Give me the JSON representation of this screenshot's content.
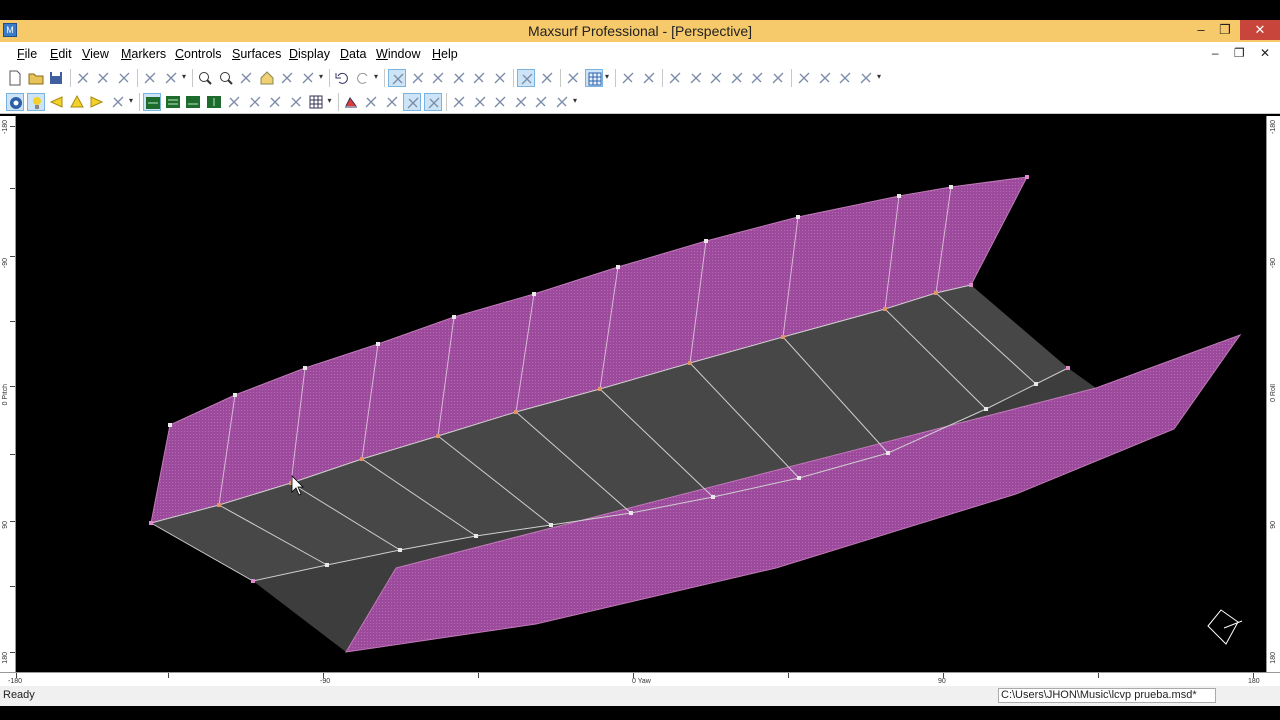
{
  "window": {
    "title": "Maxsurf Professional - [Perspective]",
    "app_icon": "M",
    "controls": {
      "minimize": "–",
      "restore": "❐",
      "close": "✕"
    }
  },
  "menu": [
    {
      "label": "File",
      "u": "F",
      "rest": "ile"
    },
    {
      "label": "Edit",
      "u": "E",
      "rest": "dit"
    },
    {
      "label": "View",
      "u": "V",
      "rest": "iew"
    },
    {
      "label": "Markers",
      "u": "M",
      "rest": "arkers"
    },
    {
      "label": "Controls",
      "u": "C",
      "rest": "ontrols"
    },
    {
      "label": "Surfaces",
      "u": "S",
      "rest": "urfaces"
    },
    {
      "label": "Display",
      "u": "D",
      "rest": "isplay"
    },
    {
      "label": "Data",
      "u": "D",
      "rest": "ata"
    },
    {
      "label": "Window",
      "u": "W",
      "rest": "indow"
    },
    {
      "label": "Help",
      "u": "H",
      "rest": "elp"
    }
  ],
  "mdi_controls": "– ❐ ✕",
  "toolbar1": [
    "new-file-icon",
    "open-folder-icon",
    "save-icon",
    "cut-icon",
    "copy-icon",
    "paste-icon",
    "print-icon",
    "help-icon",
    "zoom-in-icon",
    "zoom-out-icon",
    "pan-icon",
    "home-view-icon",
    "rotate-icon",
    "shade-icon",
    "undo-icon",
    "redo-icon",
    "select-controls-icon",
    "add-control-icon",
    "delete-control-icon",
    "pointer-icon",
    "align-icon",
    "group-icon",
    "compact-icon",
    "controls-on-icon",
    "curve-icon",
    "grid-icon",
    "pen-icon",
    "circle-icon",
    "line-icon",
    "arc-icon",
    "tangent-icon",
    "bond-icon",
    "straighten-icon",
    "smooth-icon",
    "flatten-icon",
    "extrude-icon",
    "fit-icon",
    "crop-icon"
  ],
  "toolbar2": [
    "globe-icon",
    "light-icon",
    "arrow-left-icon",
    "tri-icon",
    "arrow-right-icon",
    "display-icon",
    "body-plan-icon",
    "plan-icon",
    "profile-icon",
    "perspective-icon",
    "sections-icon",
    "buttocks-icon",
    "waterlines-icon",
    "diagonals-icon",
    "table-icon",
    "curvature-icon",
    "net-icon",
    "surface-icon",
    "trim-icon",
    "mirror-icon",
    "contours-icon",
    "show-icon",
    "render-icon",
    "hide-icon",
    "develop-icon",
    "design-grid-icon"
  ],
  "rulers": {
    "left": [
      "-180",
      "-90",
      "0 Pitch",
      "90",
      "180"
    ],
    "right": [
      "-180",
      "-90",
      "0 Roll",
      "90",
      "180"
    ],
    "bottom": [
      "-180",
      "-90",
      "0 Yaw",
      "90",
      "180"
    ]
  },
  "colors": {
    "surface_magenta": "#a04d9e",
    "surface_grey": "#474747",
    "control_point": "#e8e8e8",
    "control_point_edge": "#e0946a",
    "title_bar": "#f6c96a"
  },
  "status": {
    "left": "Ready",
    "path": "C:\\Users\\JHON\\Music\\lcvp prueba.msd*"
  }
}
